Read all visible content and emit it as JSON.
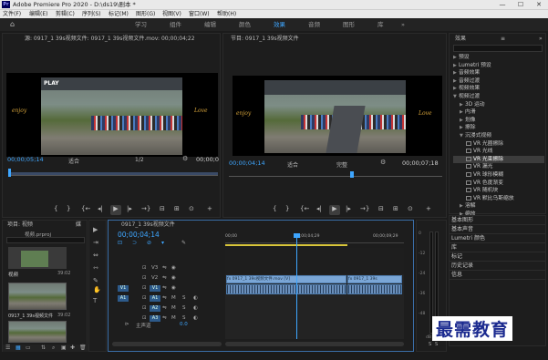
{
  "window": {
    "title": "Adobe Premiere Pro 2020 - D:\\ds19\\剧本 *",
    "logo": "Pr",
    "minimize": "—",
    "maximize": "☐",
    "close": "✕"
  },
  "menu": [
    "文件(F)",
    "编辑(E)",
    "剪辑(C)",
    "序列(S)",
    "标记(M)",
    "图形(G)",
    "视图(V)",
    "窗口(W)",
    "帮助(H)"
  ],
  "workspaces": {
    "home_icon": "home-icon",
    "tabs": [
      "学习",
      "组件",
      "编辑",
      "颜色",
      "效果",
      "音频",
      "图形",
      "库"
    ],
    "active": "效果",
    "more": "»"
  },
  "source_monitor": {
    "tab": "源: 0917_1 39s视频文件: 0917_1 39s视频文件.mov: 00;00;04;22",
    "tc_left": "00;00;05;14",
    "fit": "适合",
    "zoom": "1/2",
    "tc_right": "00;00;0"
  },
  "program_monitor": {
    "tab": "节目: 0917_1 39s视频文件",
    "tc_left": "00;00;04;14",
    "fit": "适合",
    "quality": "完整",
    "tc_right": "00;00;07;18"
  },
  "video": {
    "banner": "PLAY",
    "left_text": "enjoy",
    "right_text": "Love"
  },
  "transport": {
    "mark_in": "{",
    "mark_out": "}",
    "go_in": "{←",
    "step_back": "◂|",
    "play": "▶",
    "step_fwd": "|▸",
    "go_out": "→}",
    "insert": "⊟",
    "overwrite": "⊞",
    "export": "⊙",
    "plus": "+"
  },
  "project": {
    "tab": "项目: 视频",
    "tab2": "媒",
    "search_label": "视频.prproj",
    "items": [
      {
        "name": "视频",
        "duration": "39:02"
      },
      {
        "name": "0917_1 39s视频文件",
        "duration": "39:02"
      },
      {
        "name": "",
        "duration": ""
      }
    ]
  },
  "tools": [
    "▶",
    "⇥",
    "⇔",
    "⇿",
    "✎",
    "✋",
    "T"
  ],
  "timeline": {
    "tab": "0917_1 39s视频文件",
    "timecode": "00;00;04;14",
    "ruler": [
      "00;00",
      "00;00;04;29",
      "00;00;09;29"
    ],
    "video_tracks": [
      {
        "name": "V3",
        "source": ""
      },
      {
        "name": "V2",
        "source": ""
      },
      {
        "name": "V1",
        "source": "V1"
      }
    ],
    "audio_tracks": [
      {
        "name": "A1",
        "source": "A1"
      },
      {
        "name": "A2",
        "source": ""
      },
      {
        "name": "A3",
        "source": ""
      }
    ],
    "master": "主声道",
    "master_value": "0.0",
    "track_buttons": {
      "lock": "🔒",
      "sync": "⇋",
      "eye": "◉",
      "mute": "M",
      "solo": "S",
      "mic": "◐"
    },
    "clips": [
      {
        "label": "fx 0917_1 39s视频文件.mov [V]"
      },
      {
        "label": "fx 0917_1 39s"
      }
    ]
  },
  "effects": {
    "tab": "效果",
    "menu_icon": "≡",
    "more": "»",
    "search_placeholder": "",
    "items": [
      {
        "label": "预设",
        "indent": 0,
        "expanded": false
      },
      {
        "label": "Lumetri 预设",
        "indent": 0,
        "expanded": false
      },
      {
        "label": "音频效果",
        "indent": 0,
        "expanded": false
      },
      {
        "label": "音频过渡",
        "indent": 0,
        "expanded": false
      },
      {
        "label": "视频效果",
        "indent": 0,
        "expanded": false
      },
      {
        "label": "视频过渡",
        "indent": 0,
        "expanded": true
      },
      {
        "label": "3D 运动",
        "indent": 1,
        "expanded": false
      },
      {
        "label": "内滑",
        "indent": 1,
        "expanded": false
      },
      {
        "label": "划像",
        "indent": 1,
        "expanded": false
      },
      {
        "label": "擦除",
        "indent": 1,
        "expanded": false
      },
      {
        "label": "沉浸式视频",
        "indent": 1,
        "expanded": true
      },
      {
        "label": "VR 光圈擦除",
        "indent": 2,
        "fx": true
      },
      {
        "label": "VR 光线",
        "indent": 2,
        "fx": true
      },
      {
        "label": "VR 光束擦除",
        "indent": 2,
        "fx": true,
        "selected": true
      },
      {
        "label": "VR 漏光",
        "indent": 2,
        "fx": true
      },
      {
        "label": "VR 球形模糊",
        "indent": 2,
        "fx": true
      },
      {
        "label": "VR 色度渐变",
        "indent": 2,
        "fx": true
      },
      {
        "label": "VR 随机块",
        "indent": 2,
        "fx": true
      },
      {
        "label": "VR 默比乌斯缩放",
        "indent": 2,
        "fx": true
      },
      {
        "label": "溶解",
        "indent": 1,
        "expanded": false
      },
      {
        "label": "缩放",
        "indent": 1,
        "expanded": false
      },
      {
        "label": "页面剥落",
        "indent": 1,
        "expanded": false
      }
    ],
    "sections": [
      "基本图形",
      "基本声音",
      "Lumetri 颜色",
      "库",
      "标记",
      "历史记录",
      "信息"
    ]
  },
  "meter": {
    "labels": [
      "0",
      "-12",
      "-24",
      "-36",
      "-48",
      "dB"
    ],
    "solo": [
      "S",
      "S"
    ]
  },
  "watermark": "最需教育",
  "status": {
    "icons": [
      "list-view-icon",
      "icon-view-icon",
      "freeform-icon",
      "sort-icon",
      "search-bin-icon",
      "new-bin-icon",
      "new-item-icon",
      "trash-icon"
    ]
  },
  "colors": {
    "accent": "#3ea6ff",
    "clip_video": "#7aa6d6",
    "clip_audio": "#6a8fbb",
    "selected_track": "#2d5a8a",
    "playhead": "#3ea6ff"
  }
}
